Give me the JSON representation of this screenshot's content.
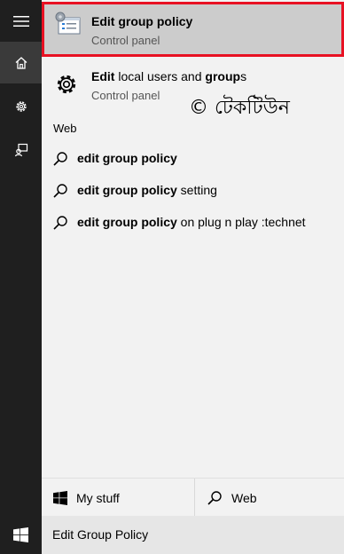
{
  "best_match": {
    "title": "Edit group policy",
    "subtitle": "Control panel",
    "icon": "group-policy-icon"
  },
  "result2": {
    "title_parts": [
      "Edit",
      " local users and ",
      "group",
      "s"
    ],
    "subtitle": "Control panel",
    "icon": "gear-icon"
  },
  "watermark": "© টেকটিউন",
  "web": {
    "header": "Web",
    "items": [
      {
        "bold": "edit group policy",
        "rest": ""
      },
      {
        "bold": "edit group policy",
        "rest": " setting"
      },
      {
        "bold": "edit group policy",
        "rest": " on plug n play :technet"
      }
    ]
  },
  "tabs": {
    "my_stuff": "My stuff",
    "web": "Web"
  },
  "search": {
    "query": "Edit Group Policy"
  },
  "colors": {
    "selection_border": "#e81123",
    "selection_bg": "#cccccc",
    "rail_bg": "#1f1f1f"
  }
}
